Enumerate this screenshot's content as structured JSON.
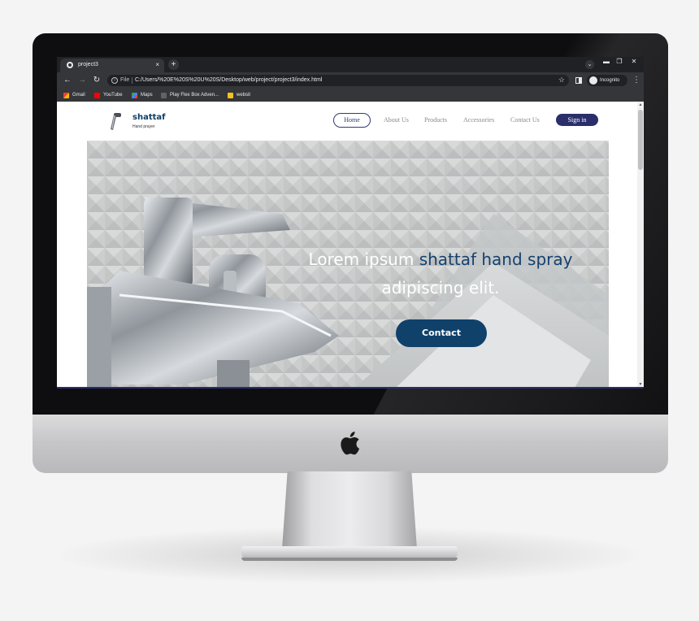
{
  "browser": {
    "tab": {
      "title": "project3",
      "close_glyph": "×"
    },
    "new_tab_glyph": "+",
    "tab_search_glyph": "⌄",
    "window_controls": {
      "minimize": "▬",
      "restore": "❐",
      "close": "✕"
    },
    "nav": {
      "back": "←",
      "forward": "→",
      "reload": "↻"
    },
    "address": {
      "info_glyph": "i",
      "scheme": "File",
      "url": "C:/Users/%20E%20S%20U%20S/Desktop/web/project/project3/index.html",
      "bookmark_glyph": "☆"
    },
    "profile_label": "Incognito",
    "menu_glyph": "⋮",
    "bookmarks": [
      {
        "label": "Gmail",
        "icon": "gmail-icon"
      },
      {
        "label": "YouTube",
        "icon": "youtube-icon"
      },
      {
        "label": "Maps",
        "icon": "maps-icon"
      },
      {
        "label": "Play Flex Box Adven...",
        "icon": "play-icon"
      },
      {
        "label": "websit",
        "icon": "folder-icon"
      }
    ],
    "scroll_up_glyph": "▲",
    "scroll_down_glyph": "▼"
  },
  "site": {
    "logo_name": "shattaf",
    "logo_tagline": "Hand prayer",
    "nav": [
      "Home",
      "About Us",
      "Products",
      "Accessories",
      "Contact Us"
    ],
    "active_nav": "Home",
    "signin_label": "Sign in",
    "hero": {
      "line1_plain": "Lorem ipsum ",
      "line1_accent": "shattaf hand spray",
      "line2": "adipiscing elit.",
      "cta_label": "Contact"
    },
    "colors": {
      "accent": "#16416e",
      "button": "#0f416b",
      "signin": "#2a2f6b"
    }
  }
}
